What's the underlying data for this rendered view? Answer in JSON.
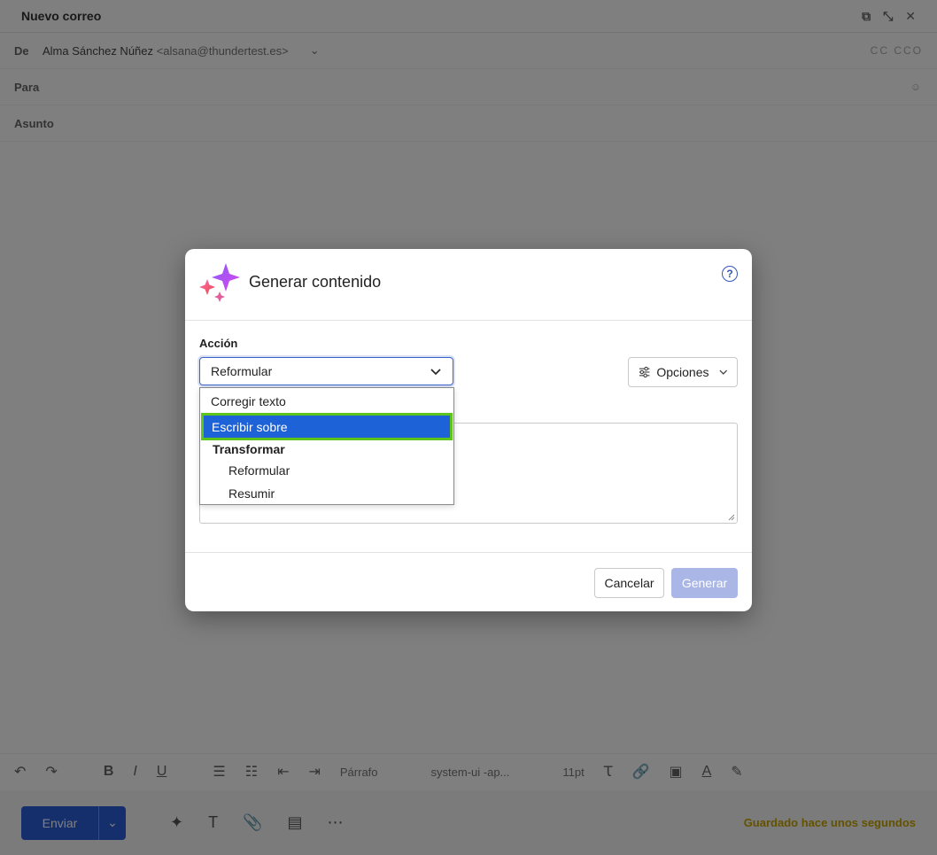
{
  "compose": {
    "title": "Nuevo correo",
    "from_label": "De",
    "from_name": "Alma Sánchez Núñez",
    "from_address": "<alsana@thundertest.es>",
    "to_label": "Para",
    "subject_label": "Asunto",
    "cc_bcc": "CC  CCO",
    "format_paragraph": "Párrafo",
    "format_font": "system-ui -ap...",
    "format_size": "11pt",
    "send_label": "Enviar",
    "saved_status": "Guardado hace unos segundos"
  },
  "dialog": {
    "title": "Generar contenido",
    "action_label": "Acción",
    "selected_action": "Reformular",
    "options_label": "Opciones",
    "cancel_label": "Cancelar",
    "generate_label": "Generar"
  },
  "dropdown": {
    "items": [
      {
        "label": "Corregir texto"
      },
      {
        "label": "Escribir sobre"
      },
      {
        "label": "Transformar"
      },
      {
        "label": "Reformular"
      },
      {
        "label": "Resumir"
      }
    ]
  },
  "colors": {
    "accent": "#3c63c8",
    "highlight": "#1d62d6",
    "highlight_outline": "#5cc41a",
    "generate_disabled": "#a9b6e6"
  },
  "icons": {
    "sparkle": "sparkle-icon",
    "help": "help-icon",
    "chevron": "chevron-down-icon",
    "options": "sliders-icon"
  }
}
